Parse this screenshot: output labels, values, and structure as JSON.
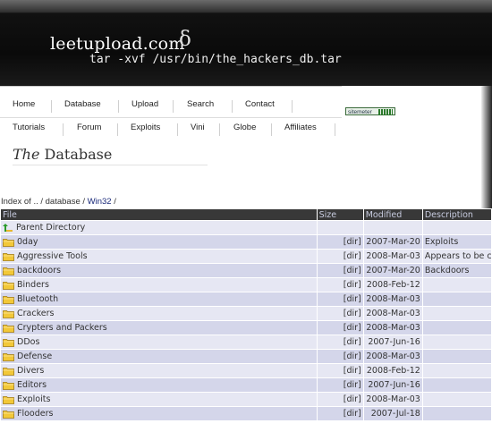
{
  "header": {
    "site_title": "leetupload.com",
    "delta_glyph": "δ",
    "tagline": "tar -xvf /usr/bin/the_hackers_db.tar"
  },
  "nav": {
    "row1": [
      "Home",
      "Database",
      "Upload",
      "Search",
      "Contact"
    ],
    "row2": [
      "Tutorials",
      "Forum",
      "Exploits",
      "Vini",
      "Globe",
      "Affiliates"
    ]
  },
  "sitemeter_label": "sitemeter",
  "page_heading": {
    "em": "The",
    "rest": " Database"
  },
  "breadcrumb": {
    "prefix": "Index of .. / database /",
    "link": "Win32",
    "suffix": "/"
  },
  "table": {
    "headers": [
      "File",
      "Size",
      "Modified",
      "Description"
    ],
    "parent": "Parent Directory",
    "rows": [
      {
        "name": "0day",
        "size": "[dir]",
        "modified": "2007-Mar-20",
        "description": "Exploits"
      },
      {
        "name": "Aggressive Tools",
        "size": "[dir]",
        "modified": "2008-Mar-03",
        "description": "Appears to be c"
      },
      {
        "name": "backdoors",
        "size": "[dir]",
        "modified": "2007-Mar-20",
        "description": "Backdoors"
      },
      {
        "name": "Binders",
        "size": "[dir]",
        "modified": "2008-Feb-12",
        "description": ""
      },
      {
        "name": "Bluetooth",
        "size": "[dir]",
        "modified": "2008-Mar-03",
        "description": ""
      },
      {
        "name": "Crackers",
        "size": "[dir]",
        "modified": "2008-Mar-03",
        "description": ""
      },
      {
        "name": "Crypters and Packers",
        "size": "[dir]",
        "modified": "2008-Mar-03",
        "description": ""
      },
      {
        "name": "DDos",
        "size": "[dir]",
        "modified": "2007-Jun-16",
        "description": ""
      },
      {
        "name": "Defense",
        "size": "[dir]",
        "modified": "2008-Mar-03",
        "description": ""
      },
      {
        "name": "Divers",
        "size": "[dir]",
        "modified": "2008-Feb-12",
        "description": ""
      },
      {
        "name": "Editors",
        "size": "[dir]",
        "modified": "2007-Jun-16",
        "description": ""
      },
      {
        "name": "Exploits",
        "size": "[dir]",
        "modified": "2008-Mar-03",
        "description": ""
      },
      {
        "name": "Flooders",
        "size": "[dir]",
        "modified": "2007-Jul-18",
        "description": ""
      }
    ]
  },
  "colors": {
    "header_bg": "#111111",
    "table_header_bg": "#383838",
    "row_bg_a": "#d4d6ea",
    "row_bg_b": "#e6e7f3",
    "folder_yellow": "#f2c838"
  }
}
